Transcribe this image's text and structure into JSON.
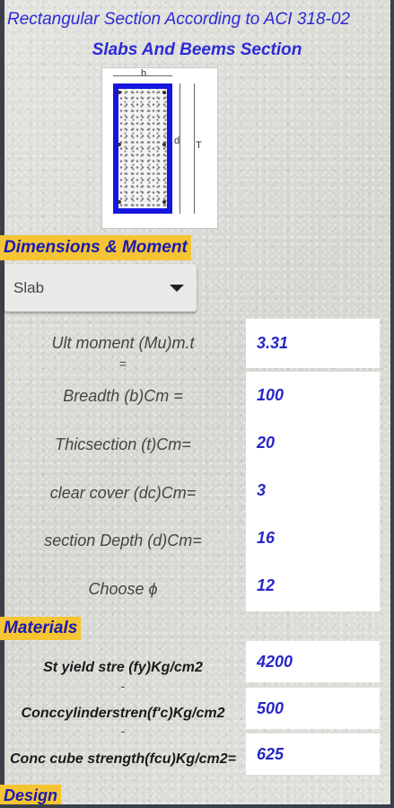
{
  "header": {
    "title": "Rectangular Section According to ACI 318-02",
    "subtitle": "Slabs And Beems Section"
  },
  "figure": {
    "b_label": "b",
    "d_label": "d",
    "t_label": "T"
  },
  "sections": {
    "dimensions": "Dimensions & Moment",
    "materials": "Materials",
    "design": "Design"
  },
  "section_type": {
    "selected": "Slab"
  },
  "dimension_fields": [
    {
      "label": "Ult moment (Mu)m.t",
      "value": "3.31",
      "note": "="
    },
    {
      "label": "Breadth  (b)Cm =",
      "value": "100"
    },
    {
      "label": "Thicsection (t)Cm=",
      "value": "20"
    },
    {
      "label": "clear cover (dc)Cm=",
      "value": "3"
    },
    {
      "label": "section Depth (d)Cm=",
      "value": "16"
    },
    {
      "label": "Choose ϕ",
      "value": "12"
    }
  ],
  "material_fields": [
    {
      "label": "St yield stre (fy)Kg/cm2",
      "value": "4200",
      "note": "-"
    },
    {
      "label": "Conccylinderstren(f'c)Kg/cm2",
      "value": "500",
      "note": "-"
    },
    {
      "label": "Conc cube strength(fcu)Kg/cm2=",
      "value": "625"
    }
  ],
  "colors": {
    "accent_text": "#2b2bd6",
    "badge_bg": "#f4c432",
    "input_text": "#2727c8",
    "section_outline": "#1616e0"
  }
}
